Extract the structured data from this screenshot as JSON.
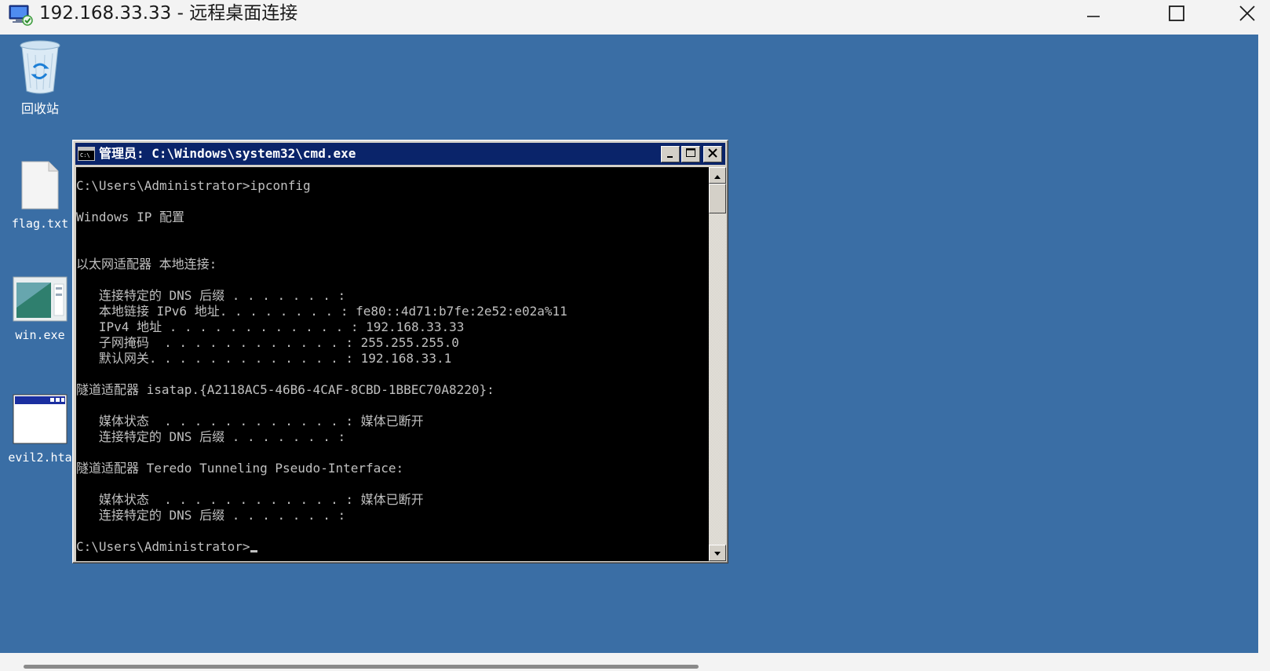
{
  "rdp_window": {
    "title": "192.168.33.33 - 远程桌面连接",
    "icon": "remote-desktop-icon",
    "controls": [
      "minimize-icon",
      "maximize-icon",
      "close-icon"
    ]
  },
  "desktop": {
    "background_color": "#3a6ea5",
    "icons": [
      {
        "name": "recycle-bin-icon",
        "label": "回收站"
      },
      {
        "name": "text-file-icon",
        "label": "flag.txt"
      },
      {
        "name": "exe-file-icon",
        "label": "win.exe"
      },
      {
        "name": "hta-file-icon",
        "label": "evil2.hta"
      }
    ]
  },
  "cmd_window": {
    "title": "管理员: C:\\Windows\\system32\\cmd.exe",
    "title_bar_color": "#0a246a",
    "lines": [
      "C:\\Users\\Administrator>ipconfig",
      "",
      "Windows IP 配置",
      "",
      "",
      "以太网适配器 本地连接:",
      "",
      "   连接特定的 DNS 后缀 . . . . . . . :",
      "   本地链接 IPv6 地址. . . . . . . . : fe80::4d71:b7fe:2e52:e02a%11",
      "   IPv4 地址 . . . . . . . . . . . . : 192.168.33.33",
      "   子网掩码  . . . . . . . . . . . . : 255.255.255.0",
      "   默认网关. . . . . . . . . . . . . : 192.168.33.1",
      "",
      "隧道适配器 isatap.{A2118AC5-46B6-4CAF-8CBD-1BBEC70A8220}:",
      "",
      "   媒体状态  . . . . . . . . . . . . : 媒体已断开",
      "   连接特定的 DNS 后缀 . . . . . . . :",
      "",
      "隧道适配器 Teredo Tunneling Pseudo-Interface:",
      "",
      "   媒体状态  . . . . . . . . . . . . : 媒体已断开",
      "   连接特定的 DNS 后缀 . . . . . . . :",
      ""
    ],
    "prompt": "C:\\Users\\Administrator>"
  }
}
